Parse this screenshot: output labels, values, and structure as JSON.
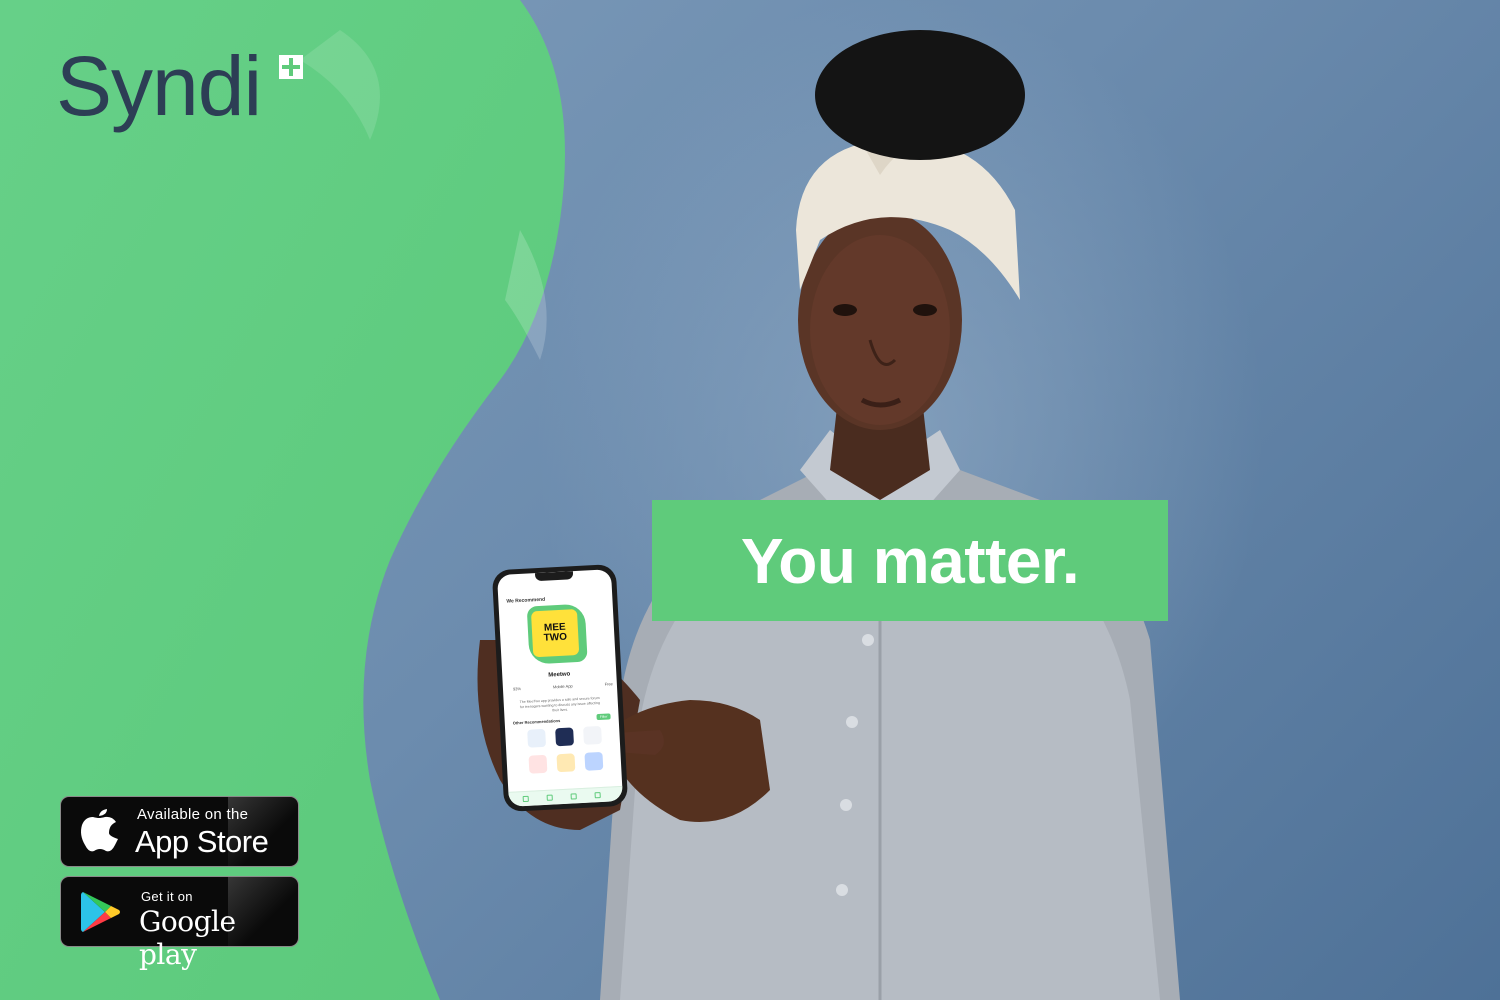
{
  "brand": {
    "logo_text": "Syndi",
    "logo_color": "#2d3e55",
    "accent": "#5fcb7b"
  },
  "hero": {
    "tagline": "You matter."
  },
  "phone_screen": {
    "heading": "We Recommend",
    "featured_app_logo_line1": "MEE",
    "featured_app_logo_line2": "TWO",
    "featured_app_name": "Meetwo",
    "rating": "93%",
    "platform": "Mobile App",
    "price": "Free",
    "description": "The MeeTwo app provides a safe and secure forum for teenagers wanting to discuss any issue affecting their lives.",
    "other_heading": "Other Recommendations",
    "filter_label": "Filter"
  },
  "badges": {
    "app_store": {
      "small": "Available on the",
      "big": "App Store",
      "icon": "apple-icon"
    },
    "google_play": {
      "small": "Get it on",
      "big": "Google play",
      "icon": "google-play-icon"
    }
  }
}
